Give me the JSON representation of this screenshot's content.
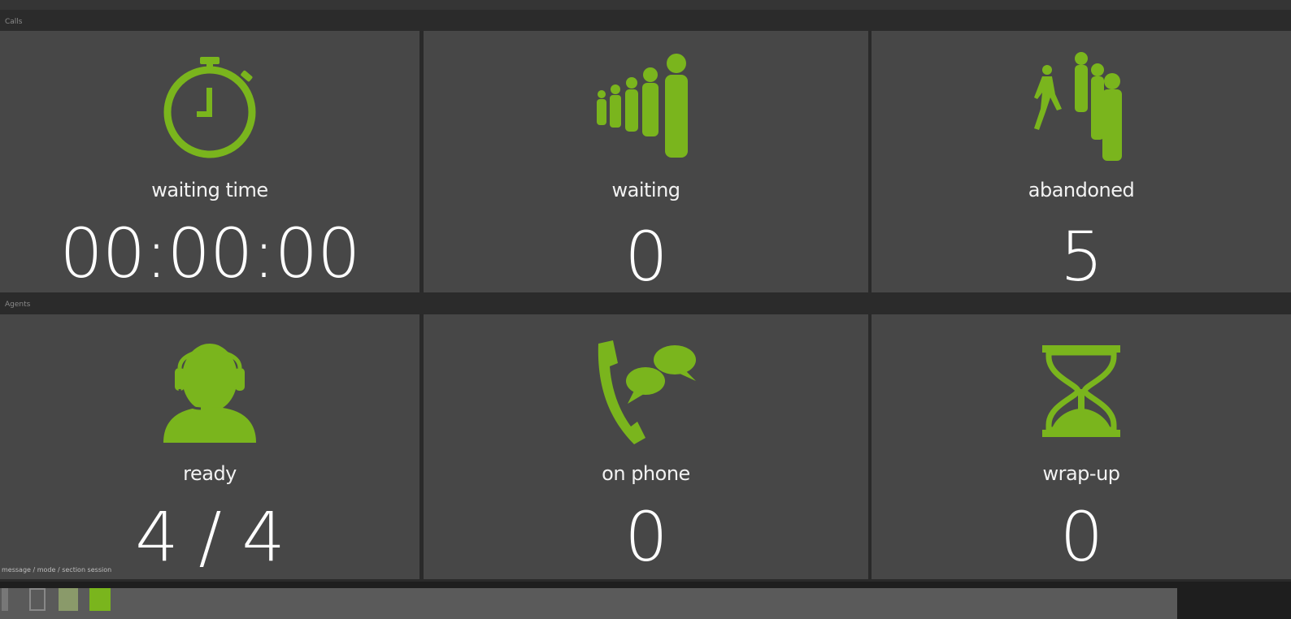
{
  "accent_color": "#7ab51d",
  "sections": {
    "top_header": "Calls",
    "bottom_header": "Agents"
  },
  "tiles": {
    "waiting_time": {
      "icon": "stopwatch-icon",
      "label": "waiting time",
      "value": "00:00:00"
    },
    "waiting": {
      "icon": "queue-people-icon",
      "label": "waiting",
      "value": "0"
    },
    "abandoned": {
      "icon": "people-leaving-icon",
      "label": "abandoned",
      "value": "5"
    },
    "ready": {
      "icon": "agent-headset-icon",
      "label": "ready",
      "value": "4 / 4"
    },
    "on_phone": {
      "icon": "phone-talk-icon",
      "label": "on phone",
      "value": "0"
    },
    "wrap_up": {
      "icon": "hourglass-icon",
      "label": "wrap-up",
      "value": "0"
    }
  },
  "footer": {
    "note": "message / mode / section session"
  }
}
